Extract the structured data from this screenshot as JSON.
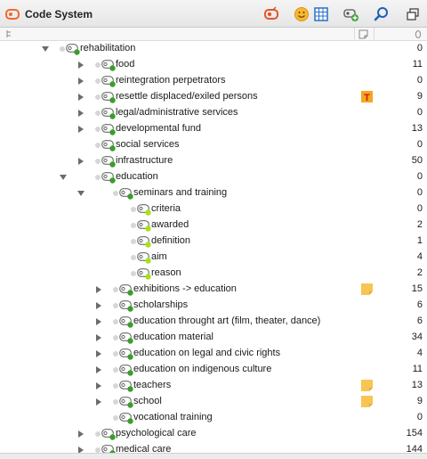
{
  "window": {
    "title": "Code System",
    "toolbar_icons": [
      "activate-codes-icon",
      "emoticon-icon",
      "code-matrix-icon",
      "new-code-icon",
      "search-icon",
      "undock-window-icon"
    ]
  },
  "columns": {
    "collapse_icon": "collapse-all-icon",
    "memo_icon": "memo-column-icon",
    "count_icon": "coded-segments-count-icon"
  },
  "colors": {
    "accent_orange": "#f5a623",
    "code_green": "#3a9e2a",
    "code_light_green": "#a4e21a",
    "memo_yellow": "#f7c652"
  },
  "rows": [
    {
      "label": "rehabilitation",
      "count": "0",
      "expanded": true,
      "has_children": true,
      "memo": ""
    },
    {
      "label": "food",
      "count": "11",
      "expanded": false,
      "has_children": true,
      "memo": ""
    },
    {
      "label": "reintegration perpetrators",
      "count": "0",
      "expanded": false,
      "has_children": true,
      "memo": ""
    },
    {
      "label": "resettle displaced/exiled persons",
      "count": "9",
      "expanded": false,
      "has_children": true,
      "memo": "T"
    },
    {
      "label": "legal/administrative services",
      "count": "0",
      "expanded": false,
      "has_children": true,
      "memo": ""
    },
    {
      "label": "developmental fund",
      "count": "13",
      "expanded": false,
      "has_children": true,
      "memo": ""
    },
    {
      "label": "social services",
      "count": "0",
      "expanded": false,
      "has_children": false,
      "memo": ""
    },
    {
      "label": "infrastructure",
      "count": "50",
      "expanded": false,
      "has_children": true,
      "memo": ""
    },
    {
      "label": "education",
      "count": "0",
      "expanded": true,
      "has_children": true,
      "memo": ""
    },
    {
      "label": "seminars and training",
      "count": "0",
      "expanded": true,
      "has_children": true,
      "memo": ""
    },
    {
      "label": "criteria",
      "count": "0",
      "expanded": false,
      "has_children": false,
      "memo": ""
    },
    {
      "label": "awarded",
      "count": "2",
      "expanded": false,
      "has_children": false,
      "memo": ""
    },
    {
      "label": "definition",
      "count": "1",
      "expanded": false,
      "has_children": false,
      "memo": ""
    },
    {
      "label": "aim",
      "count": "4",
      "expanded": false,
      "has_children": false,
      "memo": ""
    },
    {
      "label": "reason",
      "count": "2",
      "expanded": false,
      "has_children": false,
      "memo": ""
    },
    {
      "label": "exhibitions -> education",
      "count": "15",
      "expanded": false,
      "has_children": true,
      "memo": "note"
    },
    {
      "label": "scholarships",
      "count": "6",
      "expanded": false,
      "has_children": true,
      "memo": ""
    },
    {
      "label": "education throught art (film, theater, dance)",
      "count": "6",
      "expanded": false,
      "has_children": true,
      "memo": ""
    },
    {
      "label": "education material",
      "count": "34",
      "expanded": false,
      "has_children": true,
      "memo": ""
    },
    {
      "label": "education on legal and civic rights",
      "count": "4",
      "expanded": false,
      "has_children": true,
      "memo": ""
    },
    {
      "label": "education on indigenous culture",
      "count": "11",
      "expanded": false,
      "has_children": true,
      "memo": ""
    },
    {
      "label": "teachers",
      "count": "13",
      "expanded": false,
      "has_children": true,
      "memo": "note"
    },
    {
      "label": "school",
      "count": "9",
      "expanded": false,
      "has_children": true,
      "memo": "note"
    },
    {
      "label": "vocational training",
      "count": "0",
      "expanded": false,
      "has_children": false,
      "memo": ""
    },
    {
      "label": "psychological care",
      "count": "154",
      "expanded": false,
      "has_children": true,
      "memo": ""
    },
    {
      "label": "medical care",
      "count": "144",
      "expanded": false,
      "has_children": true,
      "memo": ""
    }
  ]
}
